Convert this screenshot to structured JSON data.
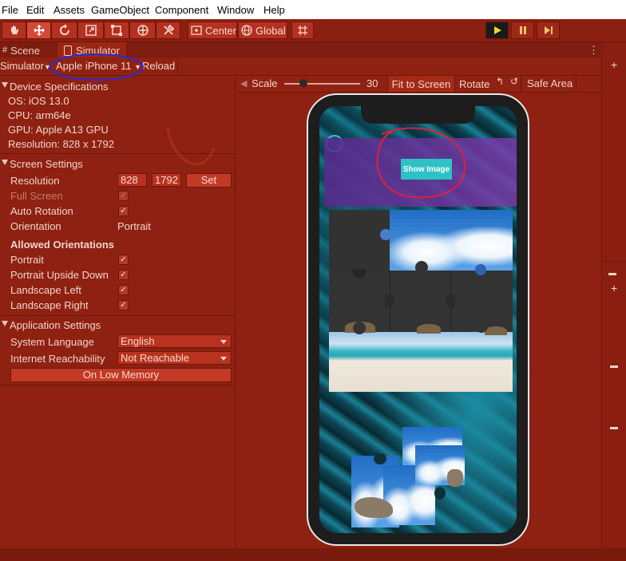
{
  "menu": [
    "File",
    "Edit",
    "Assets",
    "GameObject",
    "Component",
    "Window",
    "Help"
  ],
  "toolbar": {
    "center_label": "Center",
    "global_label": "Global"
  },
  "tabs": {
    "scene": "Scene",
    "simulator": "Simulator"
  },
  "subbar": {
    "mode": "Simulator",
    "device": "Apple iPhone 11",
    "reload": "Reload"
  },
  "device_specs": {
    "title": "Device Specifications",
    "os": "OS: iOS 13.0",
    "cpu": "CPU: arm64e",
    "gpu": "GPU: Apple A13 GPU",
    "resolution": "Resolution: 828 x 1792"
  },
  "screen_settings": {
    "title": "Screen Settings",
    "resolution_label": "Resolution",
    "res_w": "828",
    "res_h": "1792",
    "set_label": "Set",
    "full_screen": "Full Screen",
    "auto_rotation": "Auto Rotation",
    "orientation_label": "Orientation",
    "orientation_value": "Portrait",
    "allowed_title": "Allowed Orientations",
    "portrait": "Portrait",
    "portrait_upside_down": "Portrait Upside Down",
    "landscape_left": "Landscape Left",
    "landscape_right": "Landscape Right"
  },
  "app_settings": {
    "title": "Application Settings",
    "language_label": "System Language",
    "language_value": "English",
    "reach_label": "Internet Reachability",
    "reach_value": "Not Reachable",
    "low_memory": "On Low Memory"
  },
  "viewport": {
    "scale_label": "Scale",
    "scale_value": "30",
    "fit_label": "Fit to Screen",
    "rotate_label": "Rotate",
    "safe_area_label": "Safe Area"
  },
  "game": {
    "show_image_label": "Show Image"
  },
  "colors": {
    "panel": "#8e2111",
    "accent_button": "#2ec2c6",
    "annotation_blue": "#2a2ad8",
    "annotation_red": "#e0203a"
  }
}
